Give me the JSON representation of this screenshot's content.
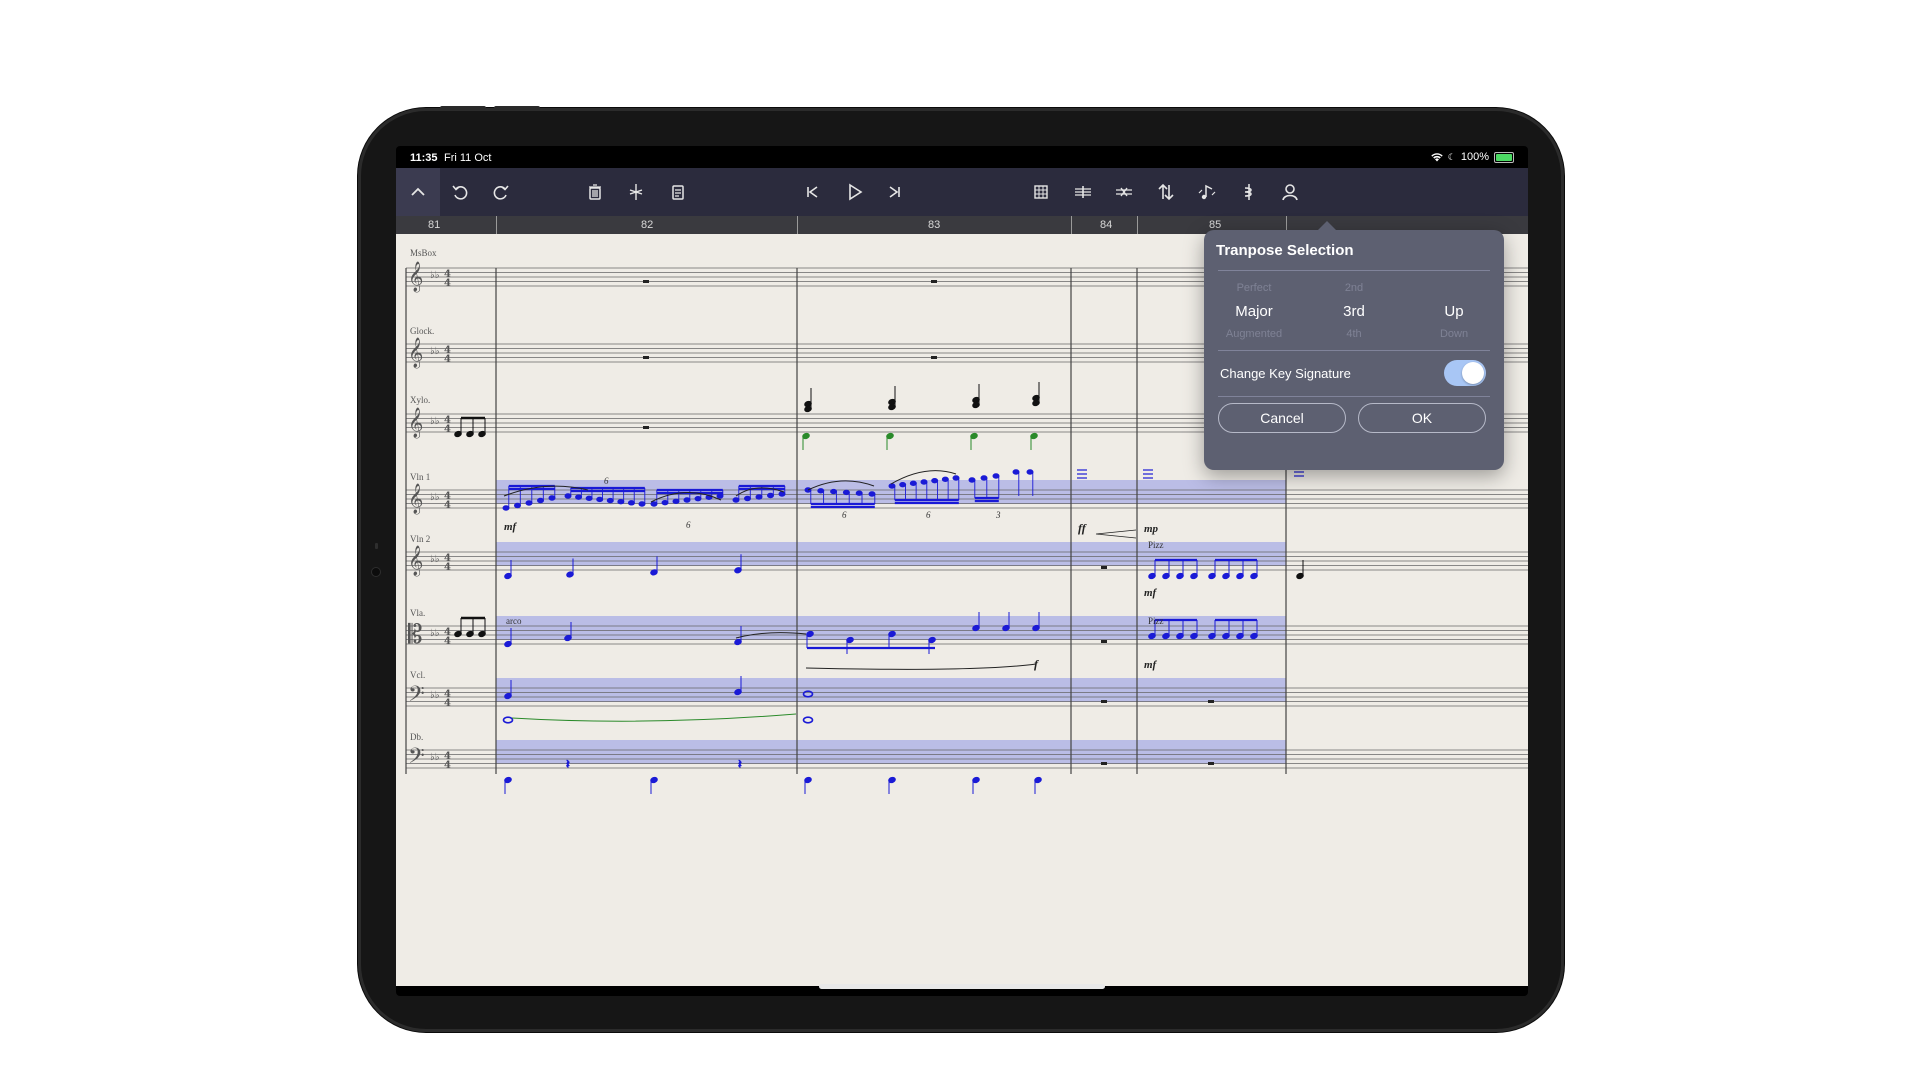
{
  "status_bar": {
    "time": "11:35",
    "date": "Fri 11 Oct",
    "battery": "100%"
  },
  "toolbar": {
    "icons": [
      "chevron-up-icon",
      "undo-icon",
      "redo-icon",
      "trash-icon",
      "scissors-icon",
      "clipboard-icon",
      "skip-back-icon",
      "play-icon",
      "skip-forward-icon",
      "grid-icon",
      "split-icon",
      "merge-icon",
      "transpose-icon",
      "notes-icon",
      "tuner-icon",
      "user-icon"
    ]
  },
  "ruler": {
    "measures": [
      "81",
      "82",
      "83",
      "84",
      "85"
    ]
  },
  "staves": [
    {
      "label": "MsBox",
      "clef": "treble"
    },
    {
      "label": "Glock.",
      "clef": "treble"
    },
    {
      "label": "Xylo.",
      "clef": "treble"
    },
    {
      "label": "Vln 1",
      "clef": "treble"
    },
    {
      "label": "Vln 2",
      "clef": "treble"
    },
    {
      "label": "Vla.",
      "clef": "alto"
    },
    {
      "label": "Vcl.",
      "clef": "bass"
    },
    {
      "label": "Db.",
      "clef": "bass"
    }
  ],
  "markings": {
    "mf1": "mf",
    "tuplet6a": "6",
    "tuplet6b": "6",
    "tuplet6c": "6",
    "tuplet6d": "6",
    "tuplet3": "3",
    "ff": "ff",
    "mp": "mp",
    "pizz1": "Pizz",
    "mf2": "mf",
    "arco": "arco",
    "pizz2": "Pizz",
    "mf3": "mf",
    "f": "f"
  },
  "popover": {
    "title": "Tranpose Selection",
    "picker": {
      "above": [
        "Perfect",
        "2nd",
        ""
      ],
      "selected": [
        "Major",
        "3rd",
        "Up"
      ],
      "below": [
        "Augmented",
        "4th",
        "Down"
      ]
    },
    "toggle_label": "Change Key Signature",
    "toggle_on": true,
    "cancel_label": "Cancel",
    "ok_label": "OK"
  },
  "colors": {
    "toolbar": "#2b2b3d",
    "paper": "#efece6",
    "selection": "#b5b8e6",
    "notes_selected": "#1a1ad6",
    "notes_green": "#2a8a2a",
    "popover": "#5d6071"
  }
}
